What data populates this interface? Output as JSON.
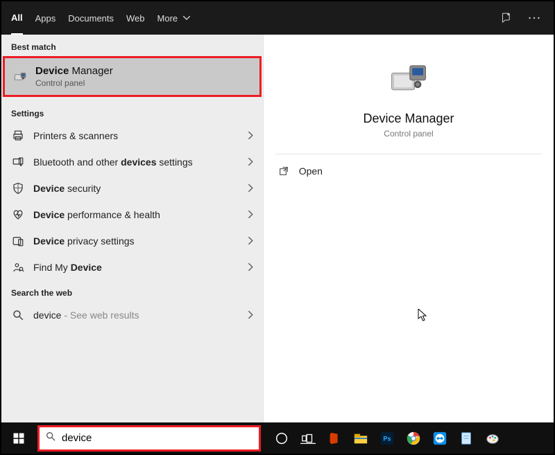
{
  "tabs": {
    "all": "All",
    "apps": "Apps",
    "documents": "Documents",
    "web": "Web",
    "more": "More"
  },
  "sections": {
    "best_match": "Best match",
    "settings": "Settings",
    "search_web": "Search the web"
  },
  "best_match_result": {
    "title_pre": "Device",
    "title_rest": " Manager",
    "subtitle": "Control panel"
  },
  "settings_items": [
    {
      "icon": "printer-icon",
      "pre": "Printers & scanners",
      "bold": "",
      "post": ""
    },
    {
      "icon": "bluetooth-icon",
      "pre": "Bluetooth and other ",
      "bold": "devices",
      "post": " settings"
    },
    {
      "icon": "shield-icon",
      "pre": "",
      "bold": "Device",
      "post": " security"
    },
    {
      "icon": "heart-icon",
      "pre": "",
      "bold": "Device",
      "post": " performance & health"
    },
    {
      "icon": "privacy-icon",
      "pre": "",
      "bold": "Device",
      "post": " privacy settings"
    },
    {
      "icon": "findmy-icon",
      "pre": "Find My ",
      "bold": "Device",
      "post": ""
    }
  ],
  "web_item": {
    "query": "device",
    "hint": "See web results"
  },
  "preview": {
    "title": "Device Manager",
    "subtitle": "Control panel",
    "open": "Open"
  },
  "search": {
    "value": "device"
  },
  "colors": {
    "highlight_border": "#ed1c24",
    "selected_bg": "#c9c9c9",
    "panel_bg": "#ededed"
  }
}
